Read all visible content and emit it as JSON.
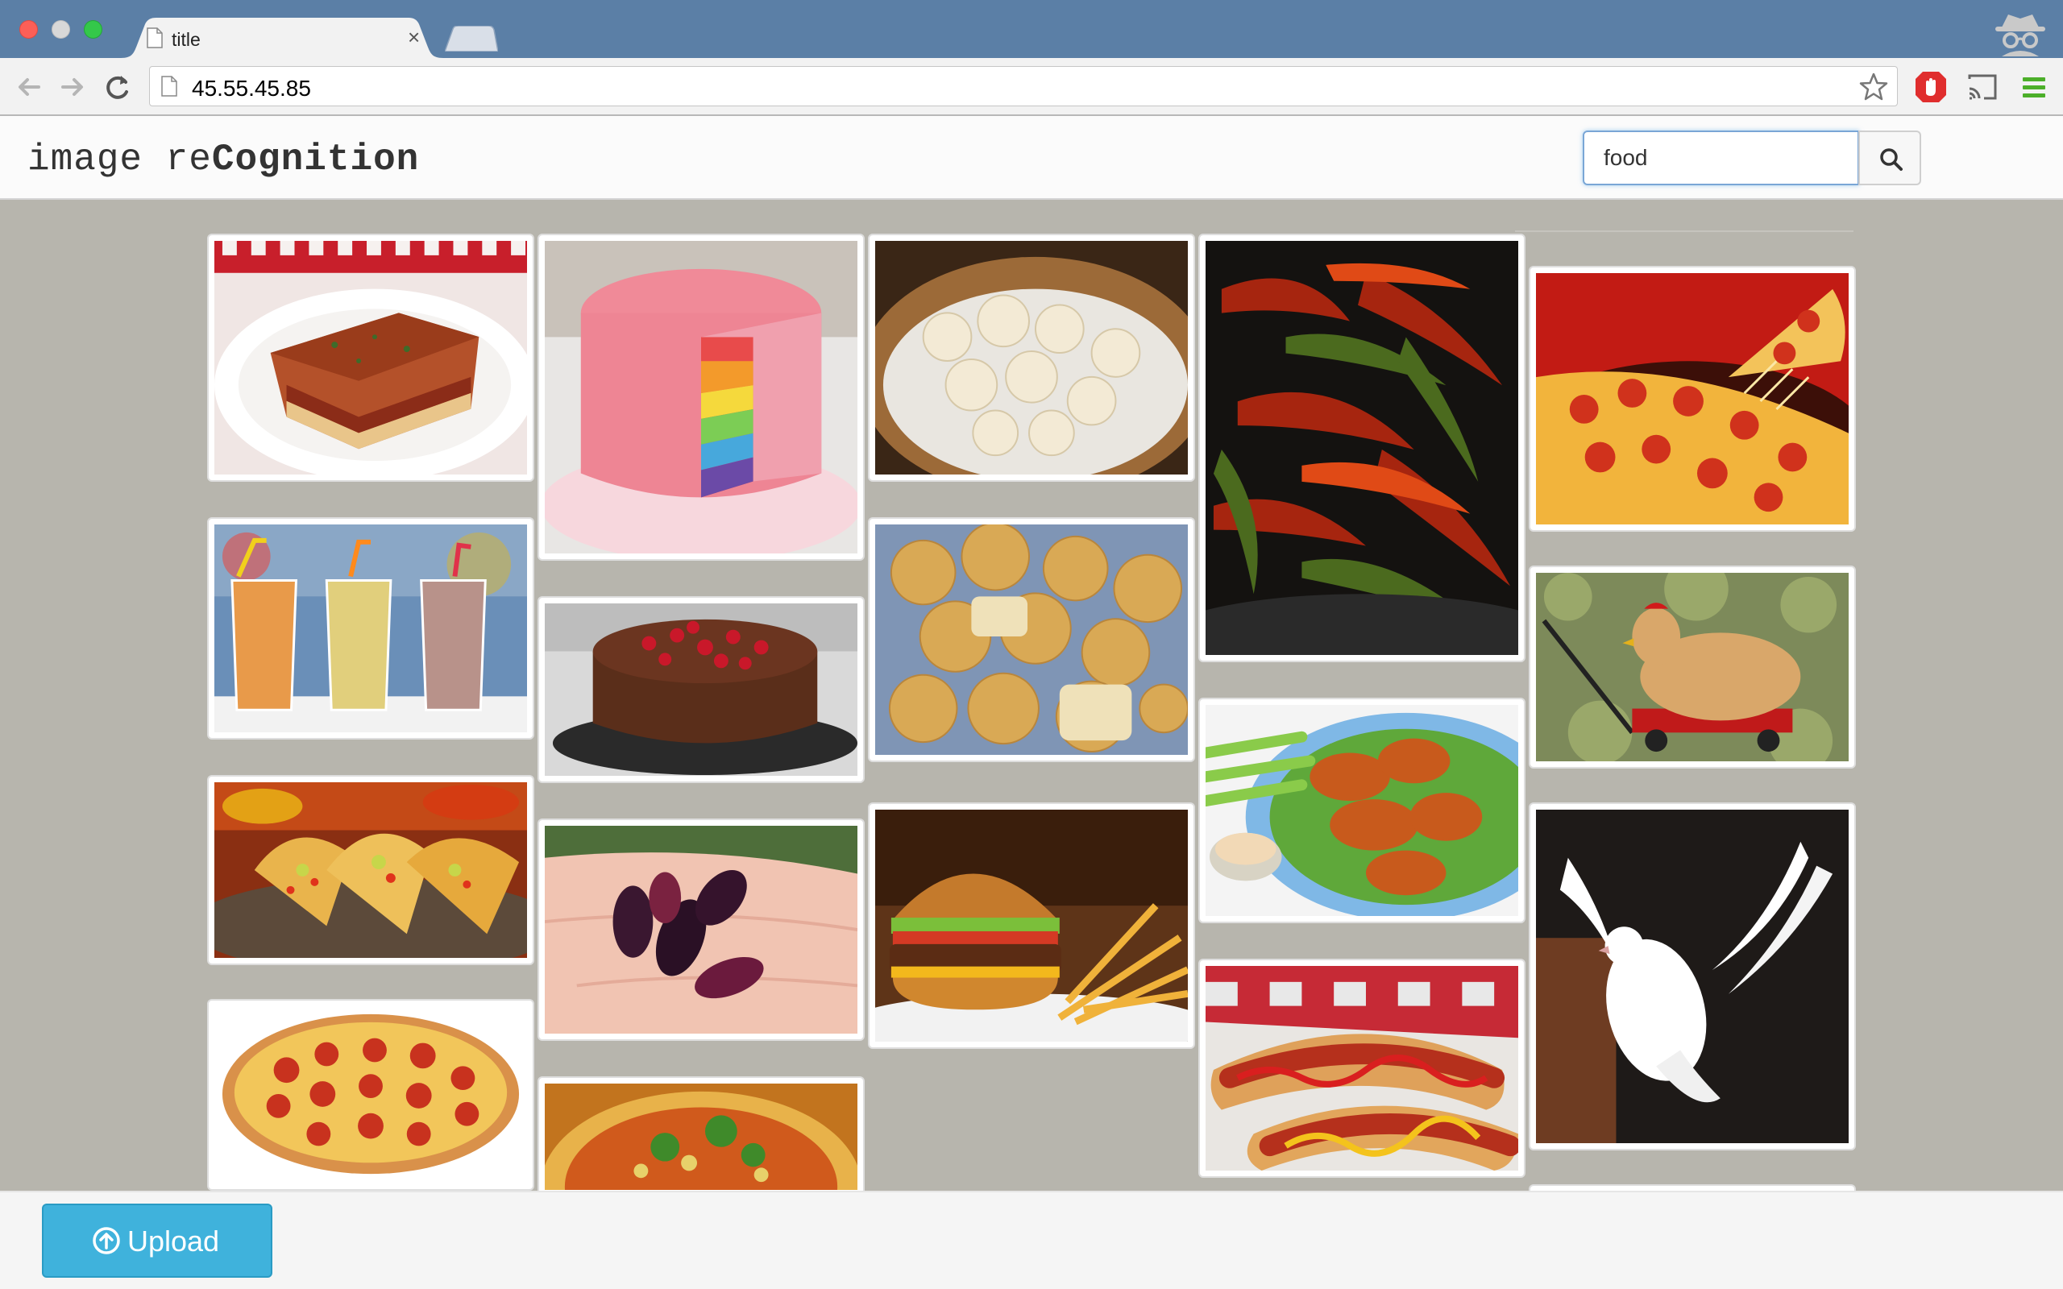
{
  "browser": {
    "tab_title": "title",
    "tab_close": "×",
    "url": "45.55.45.85"
  },
  "app": {
    "brand_light": "image re",
    "brand_bold": "Cognition",
    "search": {
      "value": "food"
    }
  },
  "gallery": {
    "items": [
      {
        "subject": "lasagna"
      },
      {
        "subject": "rainbow-cake"
      },
      {
        "subject": "dumplings"
      },
      {
        "subject": "grilled-peppers"
      },
      {
        "subject": "pepperoni-pizza-slice"
      },
      {
        "subject": "smoothies"
      },
      {
        "subject": "chocolate-cake"
      },
      {
        "subject": "muffins"
      },
      {
        "subject": "chicken-in-wagon"
      },
      {
        "subject": "tacos"
      },
      {
        "subject": "mulberries"
      },
      {
        "subject": "burger-and-fries"
      },
      {
        "subject": "chicken-wings"
      },
      {
        "subject": "white-dove"
      },
      {
        "subject": "pepperoni-pizza"
      },
      {
        "subject": "salad-plate"
      },
      {
        "subject": "hot-dogs"
      }
    ]
  },
  "footer": {
    "upload_label": "Upload"
  },
  "colors": {
    "accent": "#3fb2dc",
    "page_bg": "#b7b5ad",
    "tabstrip": "#5b7fa6"
  }
}
